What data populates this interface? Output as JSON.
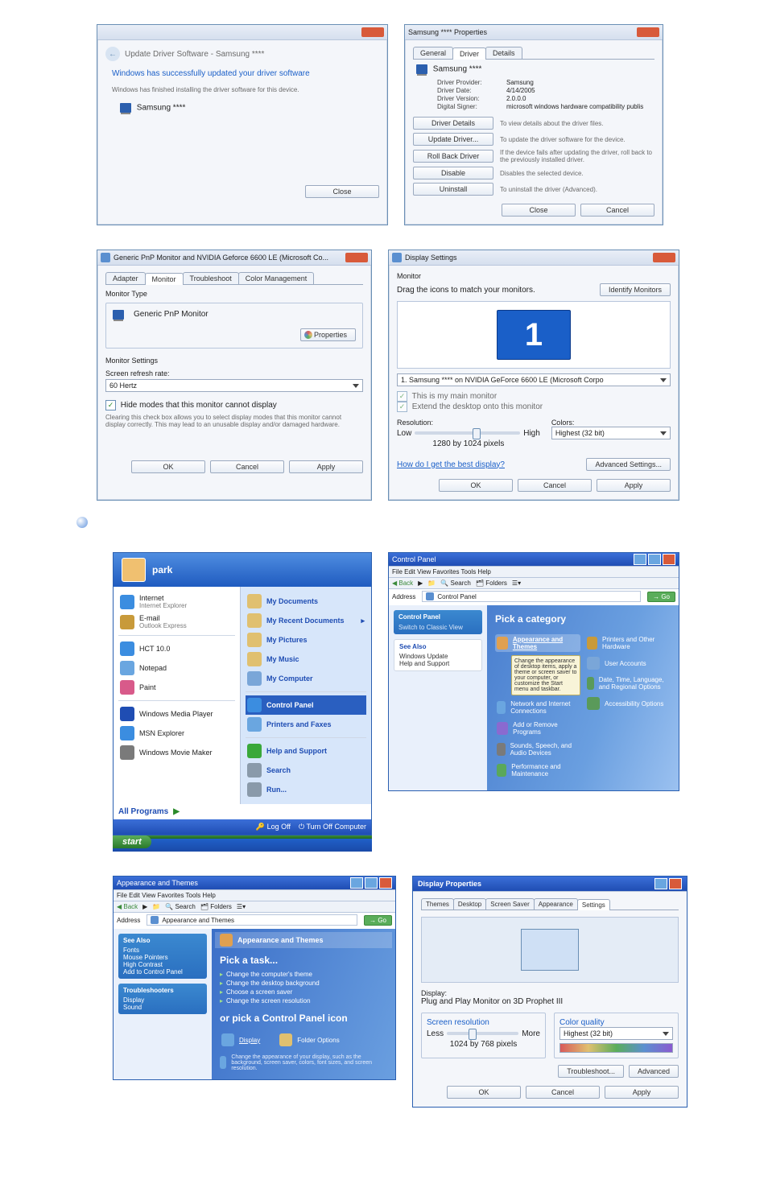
{
  "row1": {
    "update_win": {
      "back_path": "Update Driver Software - Samsung ****",
      "success": "Windows has successfully updated your driver software",
      "desc": "Windows has finished installing the driver software for this device.",
      "device": "Samsung ****",
      "close": "Close"
    },
    "props_win": {
      "title": "Samsung **** Properties",
      "tabs": [
        "General",
        "Driver",
        "Details"
      ],
      "device": "Samsung ****",
      "rows": [
        {
          "k": "Driver Provider:",
          "v": "Samsung"
        },
        {
          "k": "Driver Date:",
          "v": "4/14/2005"
        },
        {
          "k": "Driver Version:",
          "v": "2.0.0.0"
        },
        {
          "k": "Digital Signer:",
          "v": "microsoft windows hardware compatibility publis"
        }
      ],
      "buttons": [
        {
          "label": "Driver Details",
          "desc": "To view details about the driver files."
        },
        {
          "label": "Update Driver...",
          "desc": "To update the driver software for the device."
        },
        {
          "label": "Roll Back Driver",
          "desc": "If the device fails after updating the driver, roll back to the previously installed driver."
        },
        {
          "label": "Disable",
          "desc": "Disables the selected device."
        },
        {
          "label": "Uninstall",
          "desc": "To uninstall the driver (Advanced)."
        }
      ],
      "close": "Close",
      "cancel": "Cancel"
    }
  },
  "row2": {
    "monitor_win": {
      "title": "Generic PnP Monitor and NVIDIA Geforce 6600 LE (Microsoft Co...",
      "tabs": [
        "Adapter",
        "Monitor",
        "Troubleshoot",
        "Color Management"
      ],
      "type_label": "Monitor Type",
      "type_value": "Generic PnP Monitor",
      "properties_btn": "Properties",
      "settings_label": "Monitor Settings",
      "refresh_label": "Screen refresh rate:",
      "refresh_value": "60 Hertz",
      "hide_check": "Hide modes that this monitor cannot display",
      "hide_desc": "Clearing this check box allows you to select display modes that this monitor cannot display correctly. This may lead to an unusable display and/or damaged hardware.",
      "ok": "OK",
      "cancel": "Cancel",
      "apply": "Apply"
    },
    "display_win": {
      "title": "Display Settings",
      "monitor_label": "Monitor",
      "drag_text": "Drag the icons to match your monitors.",
      "identify": "Identify Monitors",
      "big_num": "1",
      "combo": "1. Samsung **** on NVIDIA GeForce 6600 LE (Microsoft Corpo",
      "main_check": "This is my main monitor",
      "extend_check": "Extend the desktop onto this monitor",
      "res_label": "Resolution:",
      "low": "Low",
      "high": "High",
      "res_value": "1280 by 1024 pixels",
      "colors_label": "Colors:",
      "colors_value": "Highest (32 bit)",
      "link": "How do I get the best display?",
      "adv": "Advanced Settings...",
      "ok": "OK",
      "cancel": "Cancel",
      "apply": "Apply"
    }
  },
  "startmenu": {
    "user": "park",
    "left": [
      {
        "t": "Internet",
        "s": "Internet Explorer",
        "c": "#3b8de0"
      },
      {
        "t": "E-mail",
        "s": "Outlook Express",
        "c": "#c89a3a"
      },
      {
        "t": "HCT 10.0",
        "s": "",
        "c": "#3b8de0"
      },
      {
        "t": "Notepad",
        "s": "",
        "c": "#6aa6e0"
      },
      {
        "t": "Paint",
        "s": "",
        "c": "#d85a8a"
      },
      {
        "t": "Windows Media Player",
        "s": "",
        "c": "#1f4db3"
      },
      {
        "t": "MSN Explorer",
        "s": "",
        "c": "#3b8de0"
      },
      {
        "t": "Windows Movie Maker",
        "s": "",
        "c": "#7a7a7a"
      }
    ],
    "right": [
      {
        "t": "My Documents",
        "c": "#e0c070"
      },
      {
        "t": "My Recent Documents",
        "c": "#e0c070",
        "arrow": true
      },
      {
        "t": "My Pictures",
        "c": "#e0c070"
      },
      {
        "t": "My Music",
        "c": "#e0c070"
      },
      {
        "t": "My Computer",
        "c": "#7aa6d8"
      },
      {
        "t": "Control Panel",
        "c": "#3b8de0",
        "hl": true
      },
      {
        "t": "Printers and Faxes",
        "c": "#6aa6e0"
      },
      {
        "t": "Help and Support",
        "c": "#3aa83a"
      },
      {
        "t": "Search",
        "c": "#8a9aaa"
      },
      {
        "t": "Run...",
        "c": "#8a9aaa"
      }
    ],
    "all": "All Programs",
    "logoff": "Log Off",
    "turnoff": "Turn Off Computer",
    "start": "start"
  },
  "controlpanel": {
    "title": "Control Panel",
    "menu": "File  Edit  View  Favorites  Tools  Help",
    "toolbar": [
      "Back",
      "",
      "Search",
      "Folders"
    ],
    "address_label": "Address",
    "address": "Control Panel",
    "side_top": "Control Panel",
    "side_switch": "Switch to Classic View",
    "side_see": "See Also",
    "side_items": [
      "Windows Update",
      "Help and Support"
    ],
    "heading": "Pick a category",
    "cats_left": [
      {
        "t": "Appearance and Themes",
        "c": "#e0a050",
        "hl": true,
        "sub": "Change the appearance of desktop items, apply a theme or screen saver to your computer, or customize the Start menu and taskbar."
      },
      {
        "t": "Network and Internet Connections",
        "c": "#6aa6e0"
      },
      {
        "t": "Add or Remove Programs",
        "c": "#8a6ad0"
      },
      {
        "t": "Sounds, Speech, and Audio Devices",
        "c": "#7a7a7a"
      },
      {
        "t": "Performance and Maintenance",
        "c": "#5aa85a"
      }
    ],
    "cats_right": [
      {
        "t": "Printers and Other Hardware",
        "c": "#c89a3a"
      },
      {
        "t": "User Accounts",
        "c": "#7aa6d8"
      },
      {
        "t": "Date, Time, Language, and Regional Options",
        "c": "#5a9a5a"
      },
      {
        "t": "Accessibility Options",
        "c": "#5a9a5a"
      }
    ]
  },
  "appthemes": {
    "title": "Appearance and Themes",
    "menu": "File  Edit  View  Favorites  Tools  Help",
    "address": "Appearance and Themes",
    "side_see": "See Also",
    "side_items": [
      "Fonts",
      "Mouse Pointers",
      "High Contrast",
      "Add to Control Panel"
    ],
    "side_tb": "Troubleshooters",
    "side_tb_items": [
      "Display",
      "Sound"
    ],
    "crumb": "Appearance and Themes",
    "pick_task": "Pick a task...",
    "tasks": [
      "Change the computer's theme",
      "Change the desktop background",
      "Choose a screen saver",
      "Change the screen resolution"
    ],
    "or_pick": "or pick a Control Panel icon",
    "icons": [
      {
        "t": "Display",
        "c": "#6aa6e0"
      },
      {
        "t": "Folder Options",
        "c": "#e0c070"
      }
    ],
    "display_desc": "Change the appearance of your display, such as the background, screen saver, colors, font sizes, and screen resolution."
  },
  "displayprops": {
    "title": "Display Properties",
    "tabs": [
      "Themes",
      "Desktop",
      "Screen Saver",
      "Appearance",
      "Settings"
    ],
    "display_label": "Display:",
    "display_value": "Plug and Play Monitor on 3D Prophet III",
    "sr_label": "Screen resolution",
    "less": "Less",
    "more": "More",
    "sr_value": "1024 by 768 pixels",
    "cq_label": "Color quality",
    "cq_value": "Highest (32 bit)",
    "troubleshoot": "Troubleshoot...",
    "advanced": "Advanced",
    "ok": "OK",
    "cancel": "Cancel",
    "apply": "Apply"
  }
}
